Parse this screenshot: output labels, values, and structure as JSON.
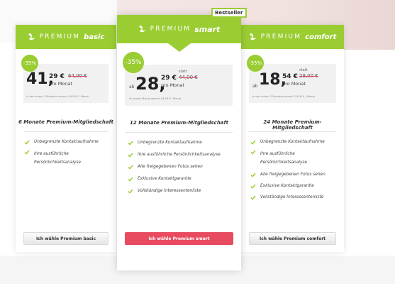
{
  "colors": {
    "accent_green": "#9acd32",
    "cta_red": "#e84a5f"
  },
  "bestseller_label": "Bestseller",
  "plans": {
    "basic": {
      "brand": "PREMIUM",
      "tier": "basic",
      "discount": "-35%",
      "price_euros": "41,",
      "price_cents": "29 €",
      "price_old": "64,00 €",
      "price_per": "pro Monat",
      "price_note": "in den ersten 3 Monaten danach 64,00 € / Monat",
      "title": "6 Monate Premium-Mitgliedschaft",
      "features": [
        "Unbegrenzte Kontaktaufnahme",
        "Ihre ausführliche Persönlichkeitsanalyse"
      ],
      "button": "Ich wähle Premium basic"
    },
    "smart": {
      "brand": "PREMIUM",
      "tier": "smart",
      "discount": "-35%",
      "price_prefix": "ab",
      "price_euros": "28,",
      "price_cents": "29 €",
      "price_statt": "statt",
      "price_old": "44,00 €",
      "price_per": "pro Monat",
      "price_note": "im ersten Monat danach 44,00 € / Monat",
      "title": "12 Monate Premium-Mitgliedschaft",
      "features": [
        "Unbegrenzte Kontaktaufnahme",
        "Ihre ausführliche Persönlichkeitsanalyse",
        "Alle freigegebenen Fotos sehen",
        "Exklusive Kontaktgarantie",
        "Vollständige Interessentenliste"
      ],
      "button": "Ich wähle Premium smart"
    },
    "comfort": {
      "brand": "PREMIUM",
      "tier": "comfort",
      "discount": "-35%",
      "price_prefix": "ab",
      "price_euros": "18,",
      "price_cents": "54 €",
      "price_statt": "statt",
      "price_old": "29,00 €",
      "price_per": "pro Monat",
      "price_note": "in den ersten 3 Monaten danach 29,00 € / Monat",
      "title": "24 Monate Premium-Mitgliedschaft",
      "features": [
        "Unbegrenzte Kontaktaufnahme",
        "Ihre ausführliche Persönlichkeitsanalyse",
        "Alle freigegebenen Fotos sehen",
        "Exklusive Kontaktgarantie",
        "Vollständige Interessentenliste"
      ],
      "button": "Ich wähle Premium comfort"
    }
  }
}
